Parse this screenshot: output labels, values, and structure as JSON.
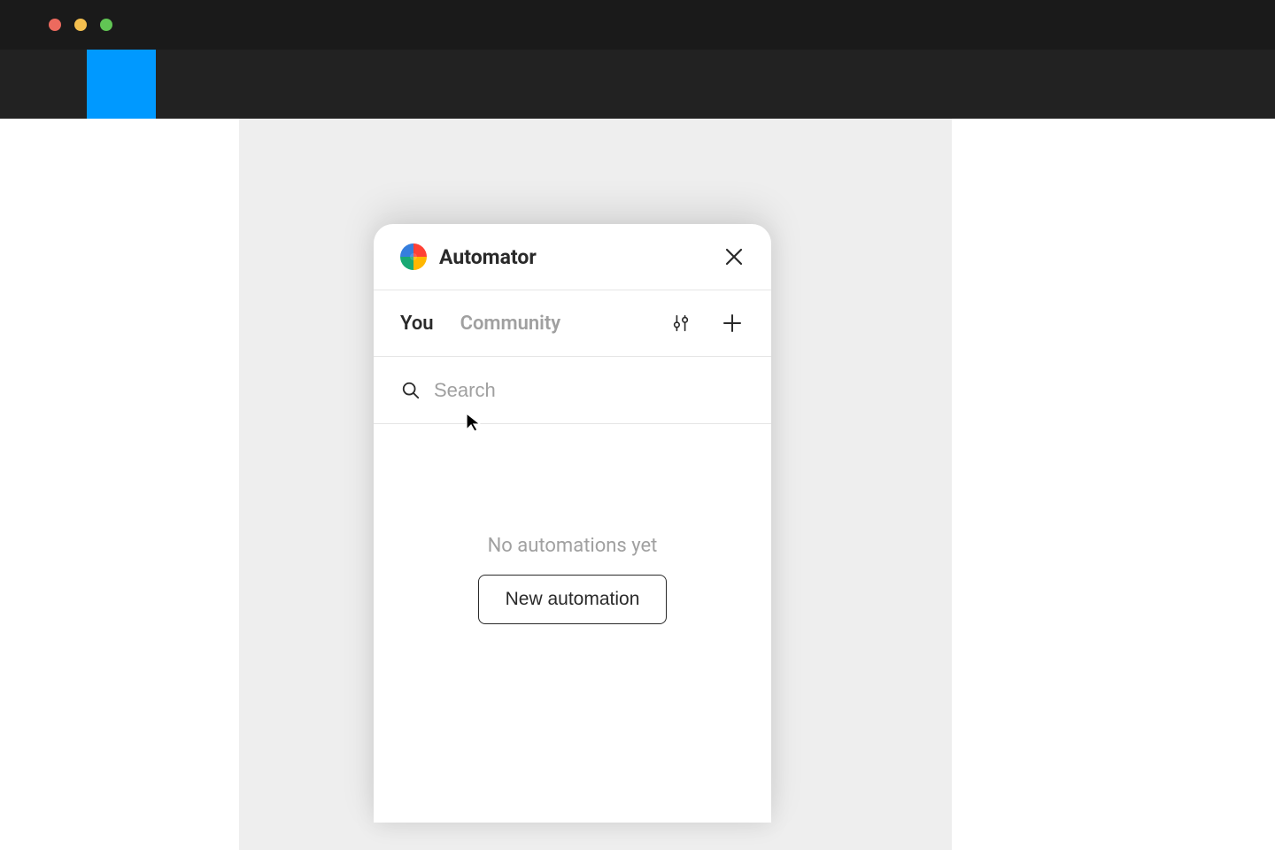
{
  "panel": {
    "title": "Automator",
    "tabs": {
      "you": "You",
      "community": "Community"
    },
    "search": {
      "placeholder": "Search"
    },
    "empty": {
      "message": "No automations yet",
      "button_label": "New automation"
    }
  }
}
